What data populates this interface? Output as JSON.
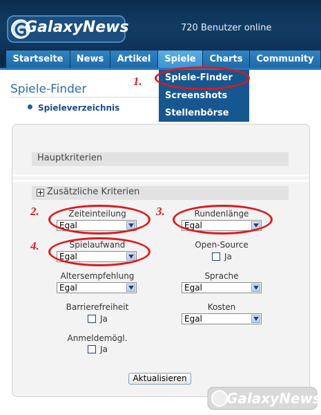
{
  "header": {
    "logo_text": "GalaxyNews",
    "online_text": "720 Benutzer online"
  },
  "nav": {
    "items": [
      "Startseite",
      "News",
      "Artikel",
      "Spiele",
      "Charts",
      "Community"
    ],
    "active": "Spiele"
  },
  "dropdown": {
    "items": [
      "Spiele-Finder",
      "Screenshots",
      "Stellenbörse"
    ]
  },
  "page": {
    "title": "Spiele-Finder",
    "link_spieleverzeichnis": "Spieleverzeichnis"
  },
  "filter": {
    "section_main": "Hauptkriterien",
    "section_extra": "Zusätzliche Kriterien",
    "expand_symbol": "+",
    "fields": {
      "zeiteinteilung": {
        "label": "Zeiteinteilung",
        "value": "Egal"
      },
      "rundenlaenge": {
        "label": "Rundenlänge",
        "value": "Egal"
      },
      "spielaufwand": {
        "label": "Spielaufwand",
        "value": "Egal"
      },
      "open_source": {
        "label": "Open-Source",
        "option": "Ja",
        "checked": false
      },
      "altersempfehlung": {
        "label": "Altersempfehlung",
        "value": "Egal"
      },
      "sprache": {
        "label": "Sprache",
        "value": "Egal"
      },
      "barrierefreiheit": {
        "label": "Barrierefreiheit",
        "option": "Ja",
        "checked": false
      },
      "kosten": {
        "label": "Kosten",
        "value": "Egal"
      },
      "anmeldemoeglichkeit": {
        "label": "Anmeldemögl.",
        "option": "Ja",
        "checked": false
      }
    },
    "submit_label": "Aktualisieren"
  },
  "annotations": [
    "1.",
    "2.",
    "3.",
    "4."
  ],
  "watermark": {
    "text": "GalaxyNews"
  },
  "colors": {
    "accent": "#2f83c2",
    "header_bg": "#123c64",
    "annotation": "#e0181c"
  }
}
